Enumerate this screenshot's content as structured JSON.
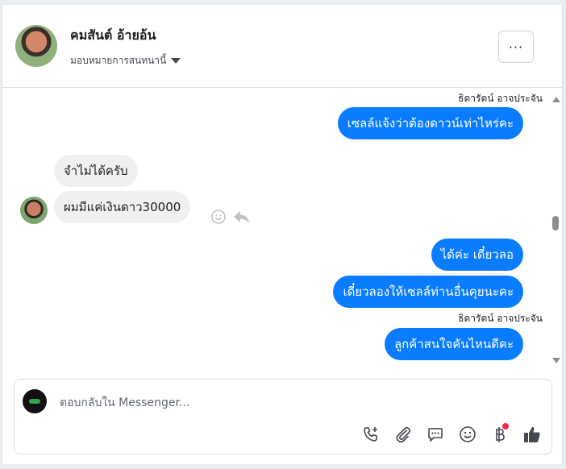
{
  "header": {
    "contact_name": "คมสันต์ อ้ายอ้น",
    "assign_label": "มอบหมายการสนทนานี้",
    "more_label": "···"
  },
  "thread": {
    "messages": [
      {
        "sender": "ธิดารัตน์ อาจประจัน",
        "text": "เซลล์แจ้งว่าต้องดาวน์เท่าไหร่คะ",
        "direction": "outgoing"
      },
      {
        "text": "จำไม่ได้ครับ",
        "direction": "incoming"
      },
      {
        "text": "ผมมีแค่เงินดาว30000",
        "direction": "incoming"
      },
      {
        "text": "ได้ค่ะ เดี๋ยวลอ",
        "direction": "outgoing"
      },
      {
        "text": "เดี๋ยวลองให้เซลล์ท่านอื่นคุยนะคะ",
        "direction": "outgoing"
      },
      {
        "sender": "ธิดารัตน์ อาจประจัน",
        "text": "ลูกค้าสนใจคันไหนดีคะ",
        "direction": "outgoing"
      }
    ]
  },
  "composer": {
    "placeholder": "ตอบกลับใน Messenger...",
    "tools": [
      "call-add-icon",
      "attachment-icon",
      "saved-reply-icon",
      "emoji-icon",
      "payment-icon",
      "like-icon"
    ]
  },
  "colors": {
    "outgoing_bubble": "#0a7cff",
    "incoming_bubble": "#f0f0f0",
    "badge": "#f02849"
  }
}
